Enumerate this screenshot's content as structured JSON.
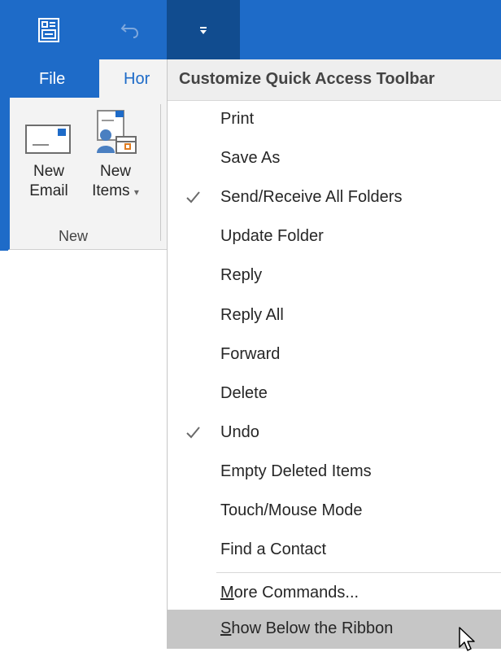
{
  "qat": {
    "app_icon": "outlook-send-receive-icon",
    "undo_icon": "undo-icon",
    "customize_icon": "customize-dropdown-icon"
  },
  "tabs": {
    "file": "File",
    "home_partial": "Hor"
  },
  "ribbon": {
    "new_email_line1": "New",
    "new_email_line2": "Email",
    "new_items_line1": "New",
    "new_items_line2": "Items",
    "group_label": "New"
  },
  "menu": {
    "header": "Customize Quick Access Toolbar",
    "items": [
      {
        "label": "Print",
        "checked": false
      },
      {
        "label": "Save As",
        "checked": false
      },
      {
        "label": "Send/Receive All Folders",
        "checked": true
      },
      {
        "label": "Update Folder",
        "checked": false
      },
      {
        "label": "Reply",
        "checked": false
      },
      {
        "label": "Reply All",
        "checked": false
      },
      {
        "label": "Forward",
        "checked": false
      },
      {
        "label": "Delete",
        "checked": false
      },
      {
        "label": "Undo",
        "checked": true
      },
      {
        "label": "Empty Deleted Items",
        "checked": false
      },
      {
        "label": "Touch/Mouse Mode",
        "checked": false
      },
      {
        "label": "Find a Contact",
        "checked": false
      }
    ],
    "more_commands": {
      "accel": "M",
      "rest": "ore Commands..."
    },
    "show_below": {
      "accel": "S",
      "rest": "how Below the Ribbon"
    }
  },
  "colors": {
    "accent": "#1e6bc8",
    "accent_dark": "#114c8f",
    "hover": "#c6c6c6"
  }
}
